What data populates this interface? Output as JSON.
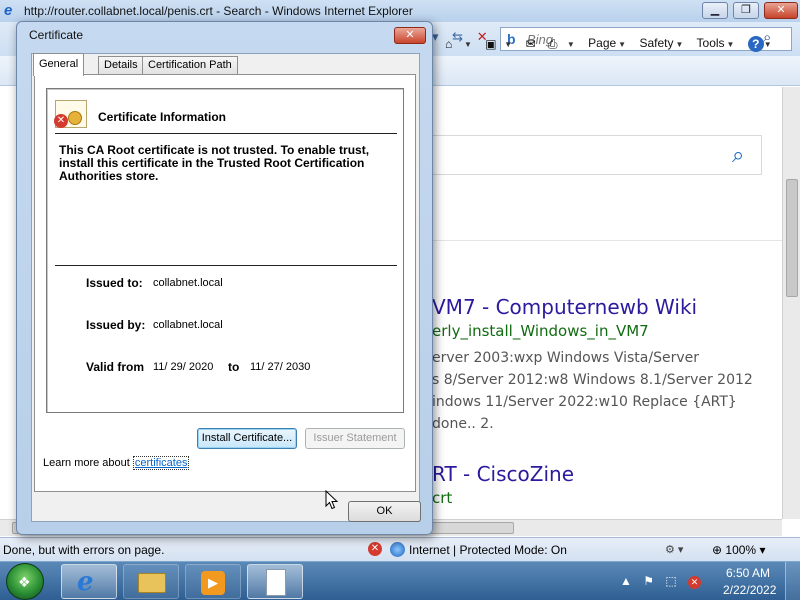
{
  "ie": {
    "title": "http://router.collabnet.local/penis.crt - Search - Windows Internet Explorer",
    "search_placeholder": "Bing",
    "toolbar": {
      "page_label": "Page",
      "safety_label": "Safety",
      "tools_label": "Tools"
    },
    "status": {
      "text": "Done, but with errors on page.",
      "zone": "Internet | Protected Mode: On",
      "zoom": "100%"
    }
  },
  "results": [
    {
      "title": "VM7 - Computernewb Wiki",
      "url": "erly_install_Windows_in_VM7"
    },
    {
      "title": "RT - CiscoZine",
      "url": "crt"
    }
  ],
  "snippet_lines": [
    "erver 2003:wxp Windows Vista/Server",
    "s 8/Server 2012:w8 Windows 8.1/Server 2012",
    "indows 11/Server 2022:w10 Replace {ART}",
    "done.. 2."
  ],
  "dialog": {
    "title": "Certificate",
    "tabs": [
      "General",
      "Details",
      "Certification Path"
    ],
    "info_title": "Certificate Information",
    "warning": "This CA Root certificate is not trusted. To enable trust, install this certificate in the Trusted Root Certification Authorities store.",
    "issued_to_label": "Issued to:",
    "issued_to": "collabnet.local",
    "issued_by_label": "Issued by:",
    "issued_by": "collabnet.local",
    "valid_from_label": "Valid from",
    "valid_from": "11/ 29/ 2020",
    "valid_to_label": "to",
    "valid_to": "11/ 27/ 2030",
    "install_button": "Install Certificate...",
    "issuer_button": "Issuer Statement",
    "learn_more_prefix": "Learn more about ",
    "learn_more_link": "certificates",
    "ok_button": "OK"
  },
  "taskbar": {
    "time": "6:50 AM",
    "date": "2/22/2022"
  }
}
